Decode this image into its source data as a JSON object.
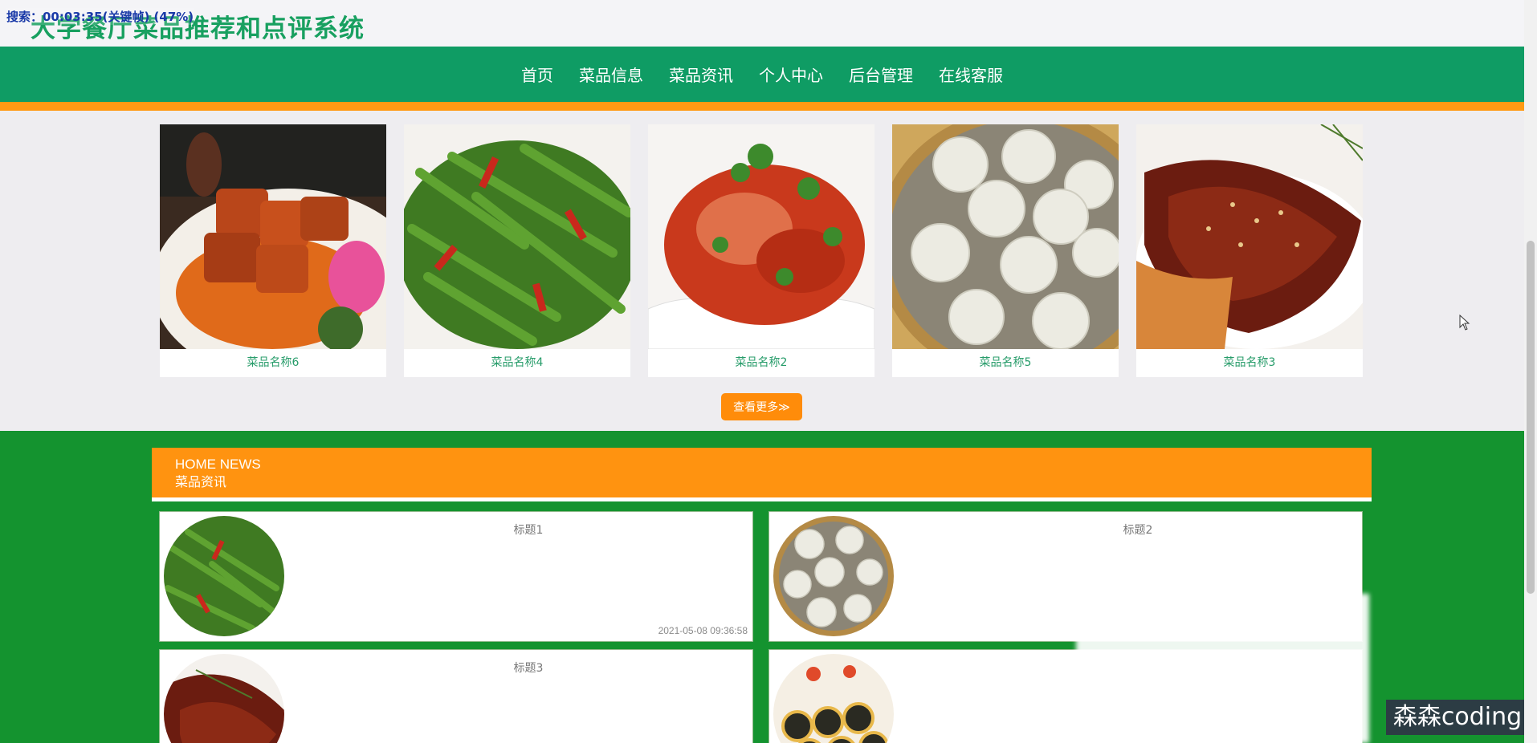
{
  "header": {
    "site_title": "大学餐厅菜品推荐和点评系统",
    "recording_overlay": "搜索：00:03:35(关键帧) (47%)"
  },
  "nav": {
    "items": [
      "首页",
      "菜品信息",
      "菜品资讯",
      "个人中心",
      "后台管理",
      "在线客服"
    ]
  },
  "dishes": [
    {
      "name": "菜品名称6"
    },
    {
      "name": "菜品名称4"
    },
    {
      "name": "菜品名称2"
    },
    {
      "name": "菜品名称5"
    },
    {
      "name": "菜品名称3"
    }
  ],
  "more_button": "查看更多≫",
  "news": {
    "title_en": "HOME NEWS",
    "title_cn": "菜品资讯",
    "items": [
      {
        "title": "标题1",
        "date": "2021-05-08 09:36:58"
      },
      {
        "title": "标题2",
        "date": ""
      },
      {
        "title": "标题3",
        "date": ""
      },
      {
        "title": "",
        "date": ""
      }
    ]
  },
  "watermark": "森森coding",
  "colors": {
    "nav_green": "#0f9c64",
    "accent_orange": "#ff9a14",
    "news_bg": "#14932f"
  }
}
